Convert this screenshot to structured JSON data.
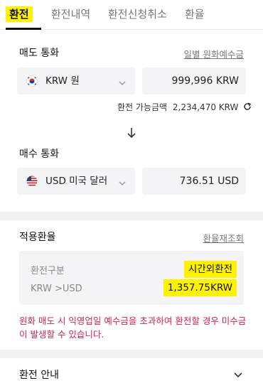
{
  "tabs": [
    {
      "label": "환전",
      "active": true
    },
    {
      "label": "환전내역",
      "active": false
    },
    {
      "label": "환전신청취소",
      "active": false
    },
    {
      "label": "환율",
      "active": false
    }
  ],
  "sell": {
    "title": "매도 통화",
    "link": "일별 원화예수금",
    "currency": "KRW 원",
    "amount": "999,996 KRW",
    "available_label": "환전 가능금액",
    "available_value": "2,234,470 KRW"
  },
  "buy": {
    "title": "매수 통화",
    "currency": "USD 미국 달러",
    "amount": "736.51 USD"
  },
  "rate": {
    "title": "적용환율",
    "link": "환율재조회",
    "type_label": "환전구분",
    "type_value": "시간외환전",
    "pair_label": "KRW >USD",
    "pair_value": "1,357.75KRW"
  },
  "warning": "원화 매도 시 익영업일 예수금을 초과하여 환전할 경우 미수금이 발생할 수 있습니다.",
  "guide": {
    "title": "환전 안내"
  },
  "colors": {
    "highlight": "#fff200",
    "warning": "#d6204f",
    "field_bg": "#f4f4f6"
  }
}
